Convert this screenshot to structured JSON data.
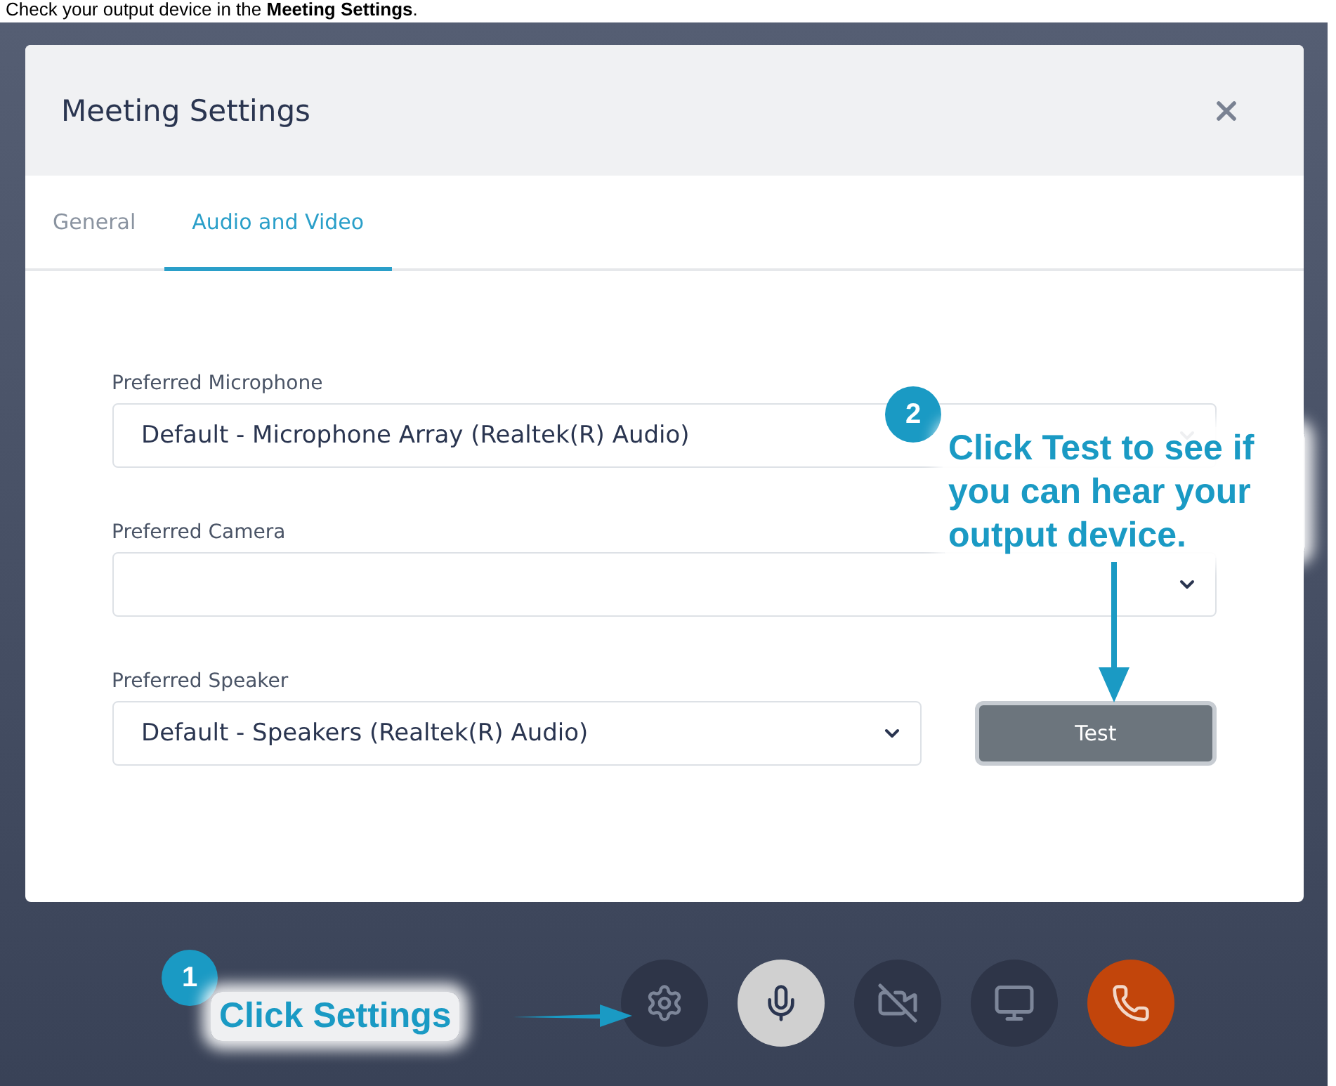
{
  "caption": "Check your output device in the **Meeting Settings**.",
  "dialog": {
    "title": "Meeting Settings",
    "tabs": [
      {
        "label": "General",
        "selected": false
      },
      {
        "label": "Audio and Video",
        "selected": true
      }
    ],
    "fields": [
      {
        "label": "Preferred Microphone",
        "value": "Default - Microphone Array (Realtek(R) Audio)"
      },
      {
        "label": "Preferred Camera"
      },
      {
        "label": "Preferred Speaker",
        "value": "Default - Speakers (Realtek(R) Audio)",
        "button": "Test"
      }
    ]
  },
  "toolbar": [
    {
      "kind": "settings"
    },
    {
      "kind": "mic",
      "on": true
    },
    {
      "kind": "camera",
      "on": false
    },
    {
      "kind": "screen"
    },
    {
      "kind": "hangup"
    }
  ],
  "callouts": [
    {
      "number": "1",
      "text": "Click Settings"
    },
    {
      "number": "2",
      "text": "Click Test to see if you can hear your output device."
    }
  ]
}
